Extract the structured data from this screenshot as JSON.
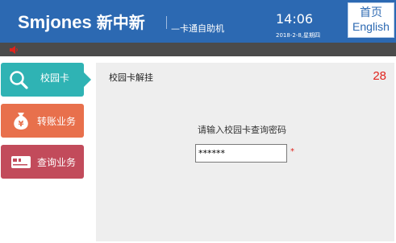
{
  "header": {
    "brand_latin": "Smjones",
    "brand_cn": "新中新",
    "subtitle": "—卡通自助机",
    "time": "14:06",
    "date": "2018-2-8,星期四",
    "home_label_cn": "首页",
    "home_label_en": "English"
  },
  "sidebar": {
    "items": [
      {
        "label": "校园卡",
        "icon": "search-icon",
        "color": "#2fb3b4",
        "active": true
      },
      {
        "label": "转账业务",
        "icon": "money-bag-icon",
        "color": "#e8704c"
      },
      {
        "label": "查询业务",
        "icon": "bank-card-icon",
        "color": "#c24b5b"
      }
    ]
  },
  "panel": {
    "title": "校园卡解挂",
    "countdown": "28",
    "prompt": "请输入校园卡查询密码",
    "password_value": "******",
    "required_mark": "*"
  },
  "colors": {
    "header_bg": "#2c69b2",
    "notice_bg": "#4b4b4b",
    "countdown": "#e0231c",
    "panel_bg": "#eeeeee"
  }
}
